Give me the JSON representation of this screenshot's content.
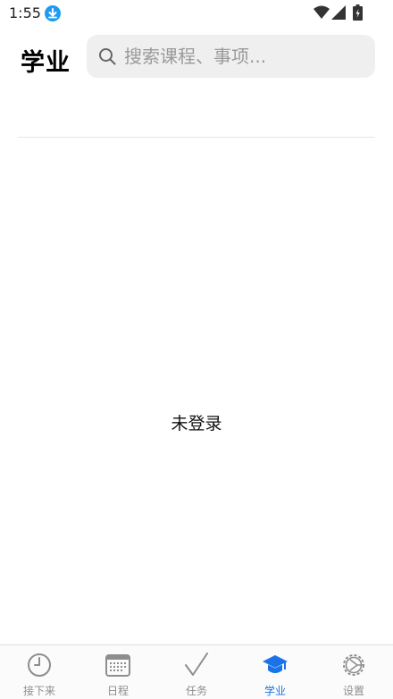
{
  "status_bar": {
    "time": "1:55"
  },
  "header": {
    "title": "学业",
    "search": {
      "placeholder": "搜索课程、事项..."
    }
  },
  "main": {
    "empty_message": "未登录"
  },
  "tab_bar": {
    "active_color": "#1a73e8",
    "inactive_color": "#8e8e8e",
    "tabs": [
      {
        "label": "接下来",
        "icon": "clock-icon",
        "active": false
      },
      {
        "label": "日程",
        "icon": "calendar-icon",
        "active": false
      },
      {
        "label": "任务",
        "icon": "checkmark-icon",
        "active": false
      },
      {
        "label": "学业",
        "icon": "graduation-cap-icon",
        "active": true
      },
      {
        "label": "设置",
        "icon": "gear-icon",
        "active": false
      }
    ]
  }
}
